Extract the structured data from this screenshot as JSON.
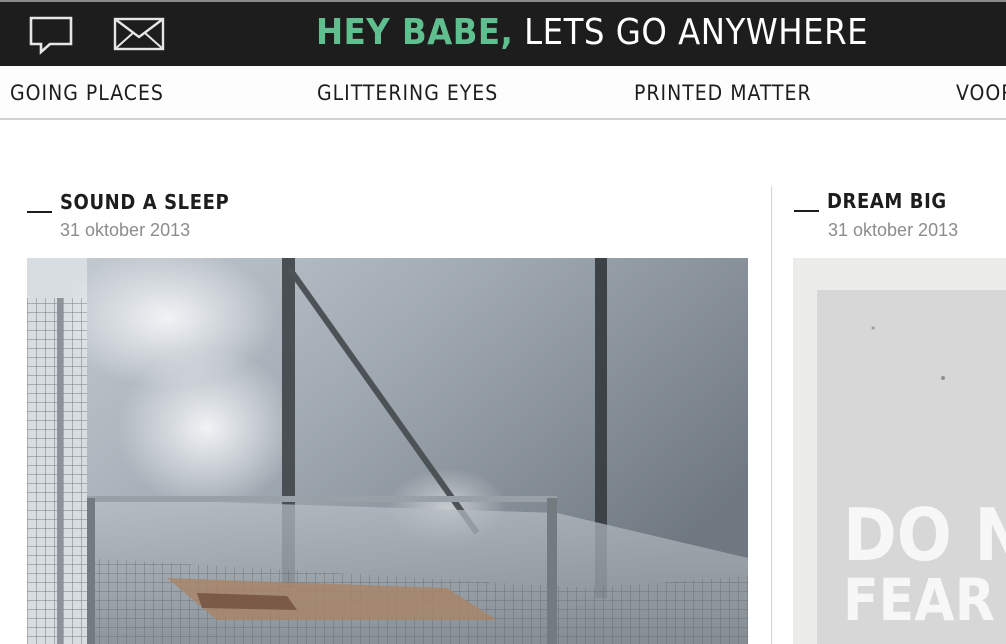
{
  "header": {
    "title_accent": "HEY BABE,",
    "title_rest": "LETS GO ANYWHERE",
    "icons": [
      "chat-bubble-icon",
      "envelope-icon"
    ],
    "colors": {
      "background": "#1d1d1d",
      "accent": "#5fbf8e",
      "text": "#ffffff"
    }
  },
  "nav": {
    "items": [
      {
        "label": "GOING PLACES"
      },
      {
        "label": "GLITTERING EYES"
      },
      {
        "label": "PRINTED MATTER"
      },
      {
        "label": "VOOR"
      }
    ]
  },
  "posts": [
    {
      "title": "SOUND A SLEEP",
      "date": "31 oktober 2013"
    },
    {
      "title": "DREAM BIG",
      "date": "31 oktober 2013",
      "poster_text": [
        "DO NO",
        "FEAR TH"
      ]
    }
  ]
}
